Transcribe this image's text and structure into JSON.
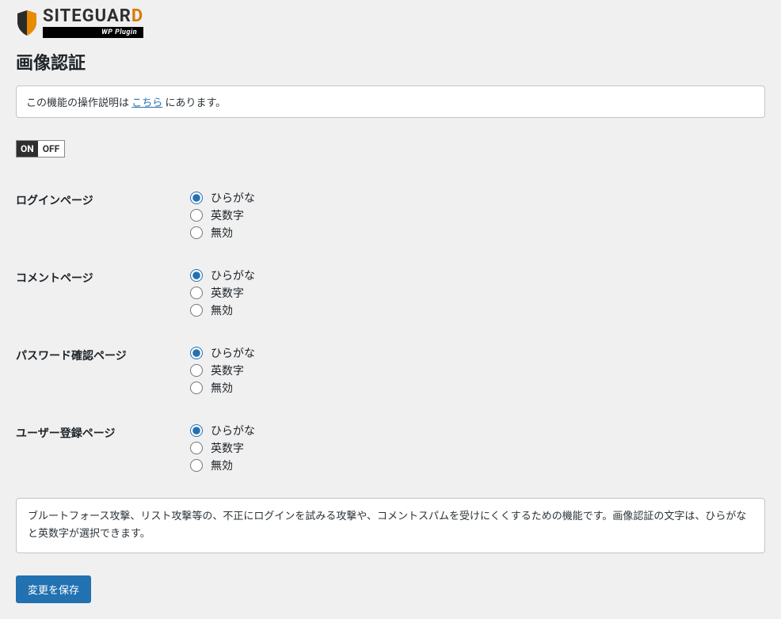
{
  "logo": {
    "brand_pre": "SITEGUAR",
    "brand_orange": "D",
    "sub": "WP Plugin"
  },
  "page_title": "画像認証",
  "notice": {
    "pre": "この機能の操作説明は ",
    "link": "こちら",
    "post": " にあります。"
  },
  "toggle": {
    "on_label": "ON",
    "off_label": "OFF"
  },
  "options": {
    "hiragana": "ひらがな",
    "alnum": "英数字",
    "disabled": "無効"
  },
  "rows": {
    "login": {
      "label": "ログインページ",
      "selected": "hiragana"
    },
    "comment": {
      "label": "コメントページ",
      "selected": "hiragana"
    },
    "lostpw": {
      "label": "パスワード確認ページ",
      "selected": "hiragana"
    },
    "register": {
      "label": "ユーザー登録ページ",
      "selected": "hiragana"
    }
  },
  "description": "ブルートフォース攻撃、リスト攻撃等の、不正にログインを試みる攻撃や、コメントスパムを受けにくくするための機能です。画像認証の文字は、ひらがなと英数字が選択できます。",
  "save_label": "変更を保存"
}
